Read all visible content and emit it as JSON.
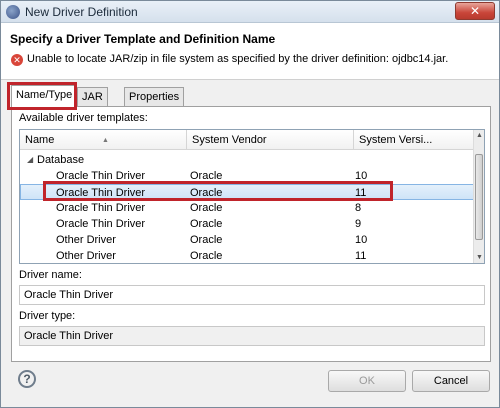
{
  "window": {
    "title": "New Driver Definition",
    "close_label": "✕",
    "icons": {
      "app": "eclipse-app-icon",
      "close": "close-icon"
    }
  },
  "header": {
    "title": "Specify a Driver Template and Definition Name",
    "error_icon": "error-icon",
    "error_message": "Unable to locate JAR/zip in file system as specified by the driver definition: ojdbc14.jar."
  },
  "tabs": [
    {
      "label": "Name/Type",
      "active": true
    },
    {
      "label": "JAR List",
      "active": false
    },
    {
      "label": "Properties",
      "active": false
    }
  ],
  "templates": {
    "label": "Available driver templates:",
    "columns": [
      "Name",
      "System Vendor",
      "System Versi..."
    ],
    "group": "Database",
    "rows": [
      {
        "name": "Oracle Thin Driver",
        "vendor": "Oracle",
        "version": "10",
        "selected": false
      },
      {
        "name": "Oracle Thin Driver",
        "vendor": "Oracle",
        "version": "11",
        "selected": true
      },
      {
        "name": "Oracle Thin Driver",
        "vendor": "Oracle",
        "version": "8",
        "selected": false
      },
      {
        "name": "Oracle Thin Driver",
        "vendor": "Oracle",
        "version": "9",
        "selected": false
      },
      {
        "name": "Other Driver",
        "vendor": "Oracle",
        "version": "10",
        "selected": false
      },
      {
        "name": "Other Driver",
        "vendor": "Oracle",
        "version": "11",
        "selected": false
      }
    ]
  },
  "driver_name": {
    "label": "Driver name:",
    "value": "Oracle Thin Driver"
  },
  "driver_type": {
    "label": "Driver type:",
    "value": "Oracle Thin Driver"
  },
  "footer": {
    "help_icon": "help-icon",
    "ok_label": "OK",
    "cancel_label": "Cancel"
  },
  "colors": {
    "highlight": "#c0242b",
    "selection": "#cfe4f8",
    "error": "#d9463a"
  }
}
